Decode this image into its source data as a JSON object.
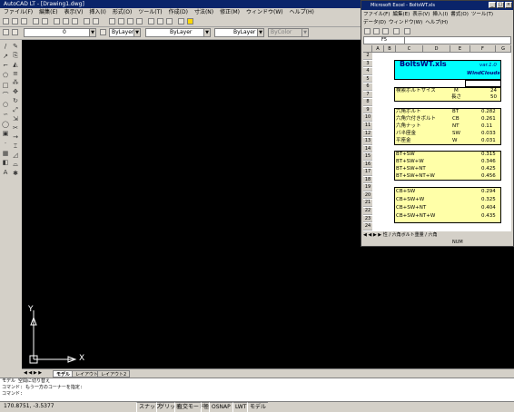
{
  "autocad": {
    "title": "AutoCAD LT - [Drawing1.dwg]",
    "menu": [
      "ファイル(F)",
      "編集(E)",
      "表示(V)",
      "挿入(I)",
      "形式(O)",
      "ツール(T)",
      "作成(D)",
      "寸法(N)",
      "修正(M)",
      "ウィンドウ(W)",
      "ヘルプ(H)"
    ],
    "layer_value": "0",
    "color_value": "ByLayer",
    "linetype_value": "ByLayer",
    "lineweight_value": "ByLayer",
    "plotstyle_value": "ByColor",
    "ucs_y": "Y",
    "ucs_x": "X",
    "tabs": [
      "モデル",
      "レイアウト1",
      "レイアウト2"
    ],
    "command_lines": [
      "モデル 空間に切り替え",
      "コマンド: もう一方のコーナーを指定:",
      "コマンド:"
    ],
    "coords": "170.8751, -3.5377",
    "status_buttons": [
      "スナップ",
      "グリッド",
      "直交モード",
      "極",
      "OSNAP",
      "LWT",
      "モデル"
    ]
  },
  "excel": {
    "title": "Microsoft Excel - BoltsWT.xls",
    "menu_row1": [
      "ファイル(F)",
      "編集(E)",
      "表示(V)",
      "挿入(I)",
      "書式(O)",
      "ツール(T)"
    ],
    "menu_row2": [
      "データ(D)",
      "ウィンドウ(W)",
      "ヘルプ(H)"
    ],
    "namebox": "F5",
    "columns": [
      "A",
      "B",
      "C",
      "D",
      "E",
      "F",
      "G"
    ],
    "rows": [
      "2",
      "3",
      "4",
      "5",
      "6",
      "7",
      "8",
      "9",
      "10",
      "11",
      "12",
      "13",
      "14",
      "15",
      "16",
      "17",
      "18",
      "19",
      "20",
      "21",
      "22",
      "23",
      "24"
    ],
    "header_title": "BoltsWT.xls",
    "header_version": "var.1.0",
    "header_author": "WindClouds",
    "input_label": "検索ボルトサイズ",
    "input_rows": [
      {
        "code": "M",
        "value": "24"
      },
      {
        "code": "長さ",
        "value": "50"
      }
    ],
    "parts": [
      {
        "name": "六角ボルト",
        "code": "BT",
        "value": "0.282"
      },
      {
        "name": "六角穴付きボルト",
        "code": "CB",
        "value": "0.261"
      },
      {
        "name": "六角ナット",
        "code": "NT",
        "value": "0.11"
      },
      {
        "name": "バネ座金",
        "code": "SW",
        "value": "0.033"
      },
      {
        "name": "平座金",
        "code": "W",
        "value": "0.031"
      }
    ],
    "bt_combos": [
      {
        "name": "BT+SW",
        "value": "0.315"
      },
      {
        "name": "BT+SW+W",
        "value": "0.346"
      },
      {
        "name": "BT+SW+NT",
        "value": "0.425"
      },
      {
        "name": "BT+SW+NT+W",
        "value": "0.456"
      }
    ],
    "cb_combos": [
      {
        "name": "CB+SW",
        "value": "0.294"
      },
      {
        "name": "CB+SW+W",
        "value": "0.325"
      },
      {
        "name": "CB+SW+NT",
        "value": "0.404"
      },
      {
        "name": "CB+SW+NT+W",
        "value": "0.435"
      }
    ],
    "sheet_tabs": "性 / 六角ボルト重量 / 六角",
    "status": "NUM"
  }
}
